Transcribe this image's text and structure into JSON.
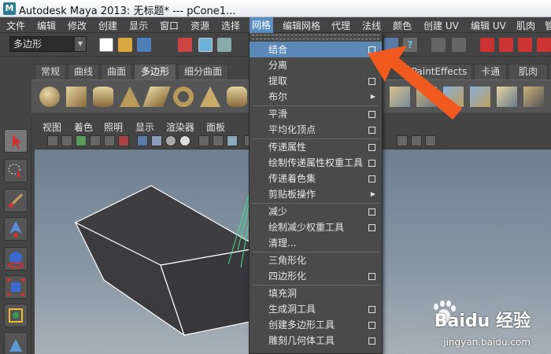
{
  "window": {
    "title": "Autodesk Maya 2013: 无标题*   ---   pCone1..."
  },
  "menubar": {
    "items": [
      "文件",
      "编辑",
      "修改",
      "创建",
      "显示",
      "窗口",
      "资源",
      "选择",
      "网格",
      "编辑网格",
      "代理",
      "法线",
      "颜色",
      "创建 UV",
      "编辑 UV",
      "肌肉",
      "管"
    ],
    "active": "网格"
  },
  "statusline": {
    "mode_value": "多边形"
  },
  "shelf": {
    "tabs": [
      "常规",
      "曲线",
      "曲面",
      "多边形",
      "细分曲面",
      "PaintEffects",
      "卡通",
      "肌肉"
    ],
    "active_tab": "多边形"
  },
  "viewport": {
    "menu": [
      "视图",
      "着色",
      "照明",
      "显示",
      "渲染器",
      "面板"
    ]
  },
  "dropdown": {
    "items": [
      {
        "label": "结合",
        "option": true,
        "submenu": false,
        "highlight": true
      },
      {
        "label": "分离",
        "option": false,
        "submenu": false
      },
      {
        "label": "提取",
        "option": true,
        "submenu": false
      },
      {
        "label": "布尔",
        "option": false,
        "submenu": true
      },
      {
        "label": "平滑",
        "option": true,
        "submenu": false
      },
      {
        "label": "平均化顶点",
        "option": true,
        "submenu": false
      },
      {
        "label": "传递属性",
        "option": true,
        "submenu": false
      },
      {
        "label": "绘制传递属性权重工具",
        "option": true,
        "submenu": false
      },
      {
        "label": "传递着色集",
        "option": true,
        "submenu": false
      },
      {
        "label": "剪贴板操作",
        "option": false,
        "submenu": true
      },
      {
        "label": "减少",
        "option": true,
        "submenu": false
      },
      {
        "label": "绘制减少权重工具",
        "option": true,
        "submenu": false
      },
      {
        "label": "清理...",
        "option": false,
        "submenu": false
      },
      {
        "label": "三角形化",
        "option": false,
        "submenu": false
      },
      {
        "label": "四边形化",
        "option": true,
        "submenu": false
      },
      {
        "label": "填充洞",
        "option": false,
        "submenu": false
      },
      {
        "label": "生成洞工具",
        "option": true,
        "submenu": false
      },
      {
        "label": "创建多边形工具",
        "option": true,
        "submenu": false
      },
      {
        "label": "雕刻几何体工具",
        "option": true,
        "submenu": false
      }
    ]
  },
  "watermark": {
    "brand": "Baidu 经验",
    "url": "jingyan.baidu.com"
  },
  "colors": {
    "highlight": "#5a89b8",
    "arrow": "#f05a1e",
    "panel": "#444444"
  }
}
